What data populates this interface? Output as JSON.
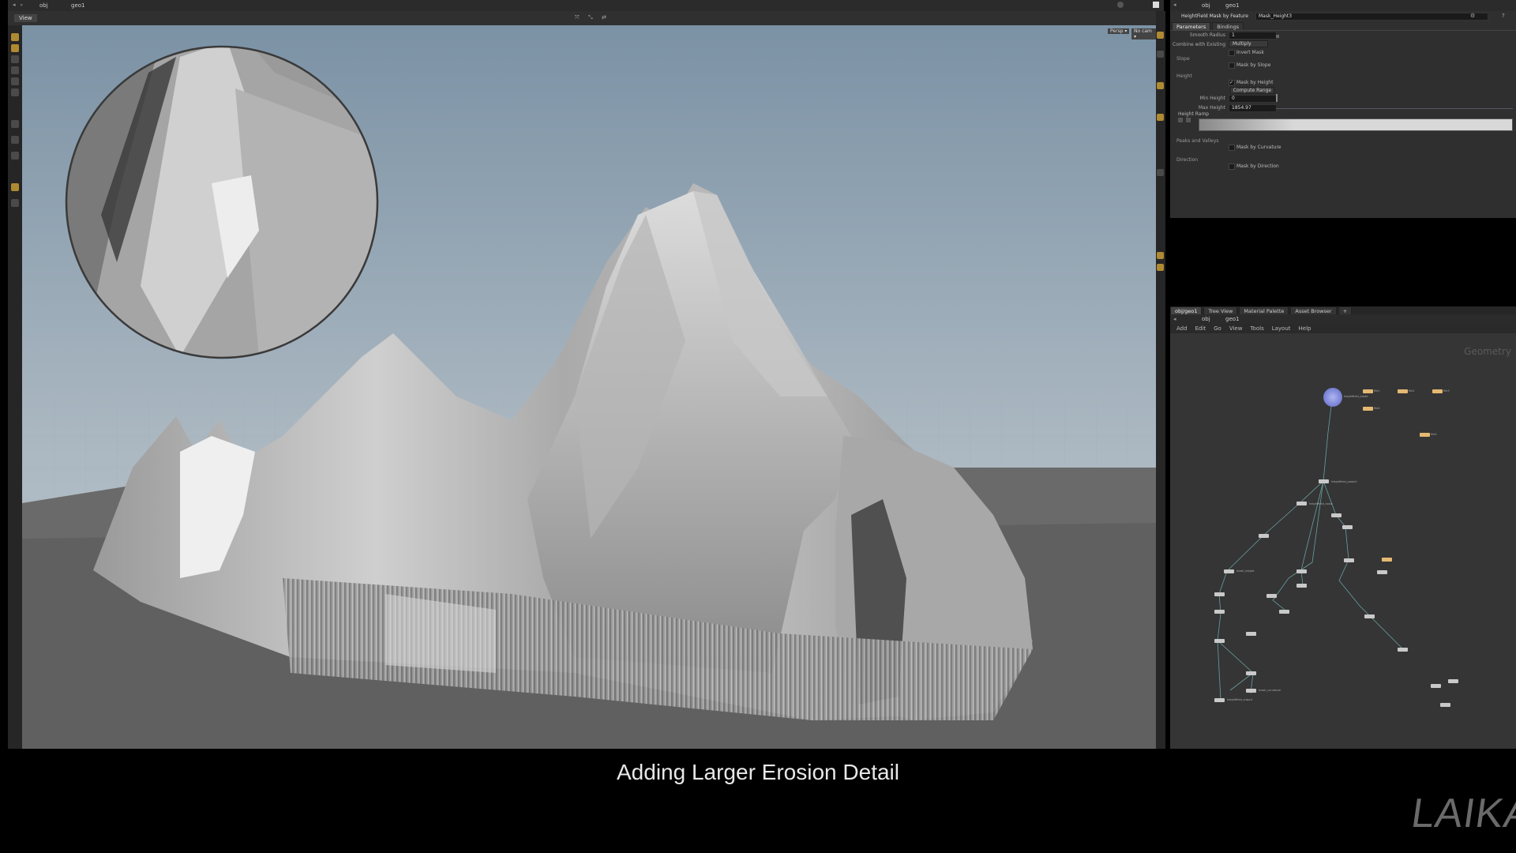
{
  "top_bar": {
    "path_obj": "obj",
    "path_geo": "geo1"
  },
  "viewport": {
    "tab_label": "View",
    "persp_label": "Persp ▾",
    "cam_label": "No cam ▾"
  },
  "params": {
    "node_type": "HeightField Mask by Feature",
    "node_name": "Mask_Height3",
    "tabs": [
      "Parameters",
      "Bindings"
    ],
    "smooth_radius_label": "Smooth Radius",
    "smooth_radius_value": "1",
    "combine_label": "Combine with Existing",
    "combine_value": "Multiply",
    "invert_mask_label": "Invert Mask",
    "slope_section": "Slope",
    "mask_by_slope_label": "Mask by Slope",
    "height_section": "Height",
    "mask_by_height_label": "Mask by Height",
    "compute_range_label": "Compute Range",
    "min_height_label": "Min Height",
    "min_height_value": "0",
    "max_height_label": "Max Height",
    "max_height_value": "1854.97",
    "height_ramp_label": "Height Ramp",
    "peaks_section": "Peaks and Valleys",
    "mask_by_curvature_label": "Mask by Curvature",
    "direction_section": "Direction",
    "mask_by_direction_label": "Mask by Direction"
  },
  "network": {
    "tabs": [
      "obj/geo1",
      "Tree View",
      "Material Palette",
      "Asset Browser"
    ],
    "path_obj": "obj",
    "path_geo": "geo1",
    "menu": [
      "Add",
      "Edit",
      "Go",
      "View",
      "Tools",
      "Layout",
      "Help"
    ],
    "context_label": "Geometry",
    "nodes": [
      {
        "label": "heightfield_erode"
      },
      {
        "label": "file1"
      },
      {
        "label": "file2"
      },
      {
        "label": "file3"
      },
      {
        "label": "file4"
      },
      {
        "label": "file5"
      },
      {
        "label": "heightfield_project"
      },
      {
        "label": "heightfield_noise"
      },
      {
        "label": "mask_height"
      },
      {
        "label": "heightfield_output"
      },
      {
        "label": "mask_curvature"
      }
    ]
  },
  "caption": "Adding Larger Erosion Detail",
  "logo": "LAIKA",
  "colors": {
    "accent": "#e5b972",
    "node_selected": "#7c85d8",
    "sky_top": "#7b92a5",
    "ground": "#606060"
  }
}
